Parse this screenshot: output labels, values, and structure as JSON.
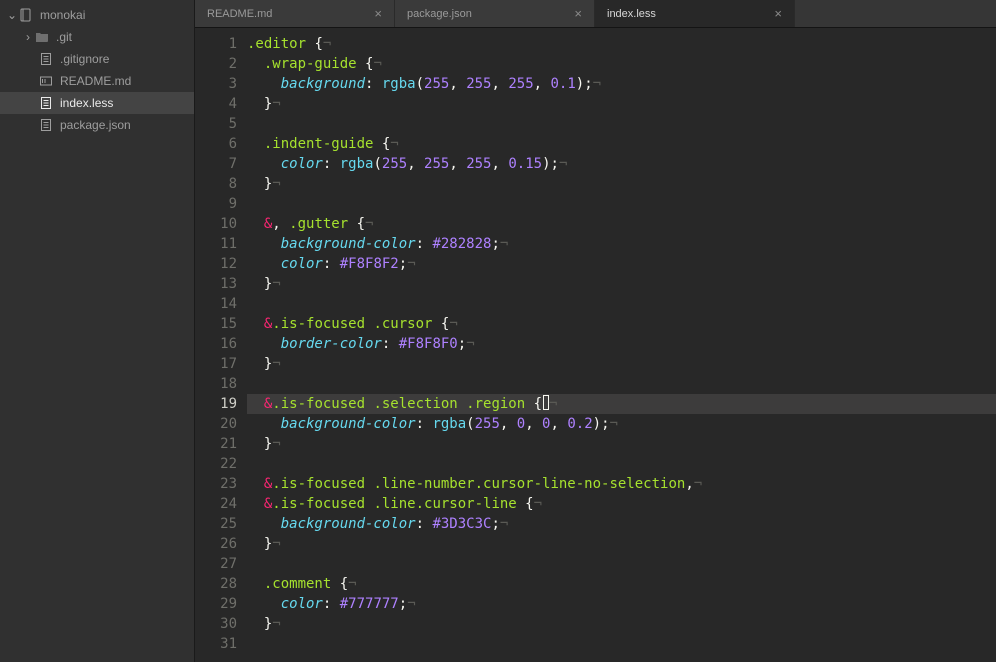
{
  "sidebar": {
    "root": "monokai",
    "items": [
      {
        "label": ".git",
        "type": "folder"
      },
      {
        "label": ".gitignore",
        "type": "file"
      },
      {
        "label": "README.md",
        "type": "file-md"
      },
      {
        "label": "index.less",
        "type": "file",
        "selected": true
      },
      {
        "label": "package.json",
        "type": "file"
      }
    ]
  },
  "tabs": [
    {
      "label": "README.md",
      "active": false
    },
    {
      "label": "package.json",
      "active": false
    },
    {
      "label": "index.less",
      "active": true
    }
  ],
  "editor": {
    "current_line": 19,
    "lines": [
      {
        "n": 1,
        "tokens": [
          [
            "sel",
            ".editor"
          ],
          [
            "punct",
            " {"
          ],
          [
            "invis",
            "¬"
          ]
        ]
      },
      {
        "n": 2,
        "tokens": [
          [
            "punct",
            "  "
          ],
          [
            "sel",
            ".wrap-guide"
          ],
          [
            "punct",
            " {"
          ],
          [
            "invis",
            "¬"
          ]
        ]
      },
      {
        "n": 3,
        "tokens": [
          [
            "punct",
            "    "
          ],
          [
            "prop",
            "background"
          ],
          [
            "punct",
            ": "
          ],
          [
            "func",
            "rgba"
          ],
          [
            "punct",
            "("
          ],
          [
            "num",
            "255"
          ],
          [
            "punct",
            ", "
          ],
          [
            "num",
            "255"
          ],
          [
            "punct",
            ", "
          ],
          [
            "num",
            "255"
          ],
          [
            "punct",
            ", "
          ],
          [
            "num",
            "0.1"
          ],
          [
            "punct",
            ");"
          ],
          [
            "invis",
            "¬"
          ]
        ]
      },
      {
        "n": 4,
        "tokens": [
          [
            "punct",
            "  }"
          ],
          [
            "invis",
            "¬"
          ]
        ]
      },
      {
        "n": 5,
        "tokens": []
      },
      {
        "n": 6,
        "tokens": [
          [
            "punct",
            "  "
          ],
          [
            "sel",
            ".indent-guide"
          ],
          [
            "punct",
            " {"
          ],
          [
            "invis",
            "¬"
          ]
        ]
      },
      {
        "n": 7,
        "tokens": [
          [
            "punct",
            "    "
          ],
          [
            "prop",
            "color"
          ],
          [
            "punct",
            ": "
          ],
          [
            "func",
            "rgba"
          ],
          [
            "punct",
            "("
          ],
          [
            "num",
            "255"
          ],
          [
            "punct",
            ", "
          ],
          [
            "num",
            "255"
          ],
          [
            "punct",
            ", "
          ],
          [
            "num",
            "255"
          ],
          [
            "punct",
            ", "
          ],
          [
            "num",
            "0.15"
          ],
          [
            "punct",
            ");"
          ],
          [
            "invis",
            "¬"
          ]
        ]
      },
      {
        "n": 8,
        "tokens": [
          [
            "punct",
            "  }"
          ],
          [
            "invis",
            "¬"
          ]
        ]
      },
      {
        "n": 9,
        "tokens": []
      },
      {
        "n": 10,
        "tokens": [
          [
            "punct",
            "  "
          ],
          [
            "amp",
            "&"
          ],
          [
            "punct",
            ", "
          ],
          [
            "sel",
            ".gutter"
          ],
          [
            "punct",
            " {"
          ],
          [
            "invis",
            "¬"
          ]
        ]
      },
      {
        "n": 11,
        "tokens": [
          [
            "punct",
            "    "
          ],
          [
            "prop",
            "background-color"
          ],
          [
            "punct",
            ": "
          ],
          [
            "num",
            "#282828"
          ],
          [
            "punct",
            ";"
          ],
          [
            "invis",
            "¬"
          ]
        ]
      },
      {
        "n": 12,
        "tokens": [
          [
            "punct",
            "    "
          ],
          [
            "prop",
            "color"
          ],
          [
            "punct",
            ": "
          ],
          [
            "num",
            "#F8F8F2"
          ],
          [
            "punct",
            ";"
          ],
          [
            "invis",
            "¬"
          ]
        ]
      },
      {
        "n": 13,
        "tokens": [
          [
            "punct",
            "  }"
          ],
          [
            "invis",
            "¬"
          ]
        ]
      },
      {
        "n": 14,
        "tokens": []
      },
      {
        "n": 15,
        "tokens": [
          [
            "punct",
            "  "
          ],
          [
            "amp",
            "&"
          ],
          [
            "sel",
            ".is-focused .cursor"
          ],
          [
            "punct",
            " {"
          ],
          [
            "invis",
            "¬"
          ]
        ]
      },
      {
        "n": 16,
        "tokens": [
          [
            "punct",
            "    "
          ],
          [
            "prop",
            "border-color"
          ],
          [
            "punct",
            ": "
          ],
          [
            "num",
            "#F8F8F0"
          ],
          [
            "punct",
            ";"
          ],
          [
            "invis",
            "¬"
          ]
        ]
      },
      {
        "n": 17,
        "tokens": [
          [
            "punct",
            "  }"
          ],
          [
            "invis",
            "¬"
          ]
        ]
      },
      {
        "n": 18,
        "tokens": []
      },
      {
        "n": 19,
        "tokens": [
          [
            "punct",
            "  "
          ],
          [
            "amp",
            "&"
          ],
          [
            "sel",
            ".is-focused .selection .region"
          ],
          [
            "punct",
            " {"
          ],
          [
            "caret",
            ""
          ],
          [
            "invis",
            "¬"
          ]
        ]
      },
      {
        "n": 20,
        "tokens": [
          [
            "punct",
            "    "
          ],
          [
            "prop",
            "background-color"
          ],
          [
            "punct",
            ": "
          ],
          [
            "func",
            "rgba"
          ],
          [
            "punct",
            "("
          ],
          [
            "num",
            "255"
          ],
          [
            "punct",
            ", "
          ],
          [
            "num",
            "0"
          ],
          [
            "punct",
            ", "
          ],
          [
            "num",
            "0"
          ],
          [
            "punct",
            ", "
          ],
          [
            "num",
            "0.2"
          ],
          [
            "punct",
            ");"
          ],
          [
            "invis",
            "¬"
          ]
        ]
      },
      {
        "n": 21,
        "tokens": [
          [
            "punct",
            "  }"
          ],
          [
            "invis",
            "¬"
          ]
        ]
      },
      {
        "n": 22,
        "tokens": []
      },
      {
        "n": 23,
        "tokens": [
          [
            "punct",
            "  "
          ],
          [
            "amp",
            "&"
          ],
          [
            "sel",
            ".is-focused .line-number.cursor-line-no-selection"
          ],
          [
            "punct",
            ","
          ],
          [
            "invis",
            "¬"
          ]
        ]
      },
      {
        "n": 24,
        "tokens": [
          [
            "punct",
            "  "
          ],
          [
            "amp",
            "&"
          ],
          [
            "sel",
            ".is-focused .line.cursor-line"
          ],
          [
            "punct",
            " {"
          ],
          [
            "invis",
            "¬"
          ]
        ]
      },
      {
        "n": 25,
        "tokens": [
          [
            "punct",
            "    "
          ],
          [
            "prop",
            "background-color"
          ],
          [
            "punct",
            ": "
          ],
          [
            "num",
            "#3D3C3C"
          ],
          [
            "punct",
            ";"
          ],
          [
            "invis",
            "¬"
          ]
        ]
      },
      {
        "n": 26,
        "tokens": [
          [
            "punct",
            "  }"
          ],
          [
            "invis",
            "¬"
          ]
        ]
      },
      {
        "n": 27,
        "tokens": []
      },
      {
        "n": 28,
        "tokens": [
          [
            "punct",
            "  "
          ],
          [
            "sel",
            ".comment"
          ],
          [
            "punct",
            " {"
          ],
          [
            "invis",
            "¬"
          ]
        ]
      },
      {
        "n": 29,
        "tokens": [
          [
            "punct",
            "    "
          ],
          [
            "prop",
            "color"
          ],
          [
            "punct",
            ": "
          ],
          [
            "num",
            "#777777"
          ],
          [
            "punct",
            ";"
          ],
          [
            "invis",
            "¬"
          ]
        ]
      },
      {
        "n": 30,
        "tokens": [
          [
            "punct",
            "  }"
          ],
          [
            "invis",
            "¬"
          ]
        ]
      },
      {
        "n": 31,
        "tokens": []
      }
    ]
  },
  "close_glyph": "×"
}
